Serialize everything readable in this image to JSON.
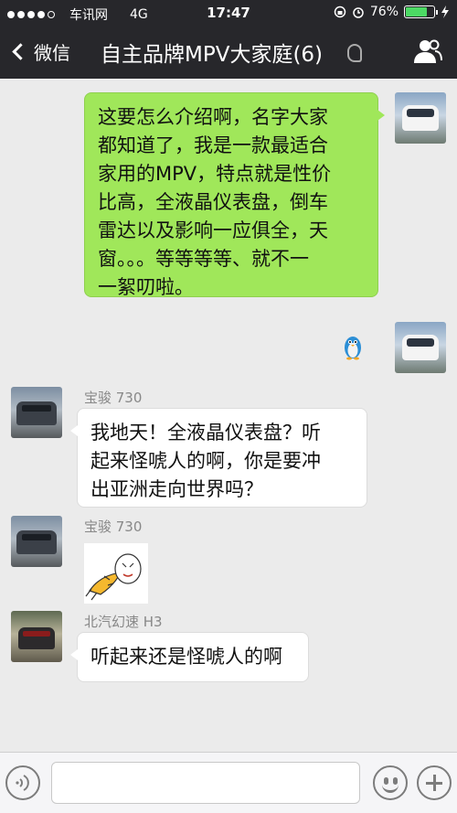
{
  "status_bar": {
    "carrier": "车讯网",
    "network": "4G",
    "time": "17:47",
    "battery": "76%",
    "battery_level": 0.76
  },
  "nav": {
    "back_label": "微信",
    "title": "自主品牌MPV大家庭(6)"
  },
  "messages": [
    {
      "from": "me",
      "type": "text",
      "lines": [
        "这要怎么介绍啊，名字大家",
        "都知道了，我是一款最适合",
        "家用的MPV，特点就是性价",
        "比高，全液晶仪表盘，倒车",
        "雷达以及影响一应俱全，天",
        "窗。。。等等等等、就不一",
        "一絮叨啦。"
      ]
    },
    {
      "from": "me",
      "type": "sticker",
      "sticker": "blue-penguin"
    },
    {
      "from": "them",
      "sender": "宝骏 730",
      "type": "text",
      "lines": [
        "我地天！全液晶仪表盘？听",
        "起来怪唬人的啊，你是要冲",
        "出亚洲走向世界吗？"
      ]
    },
    {
      "from": "them",
      "sender": "宝骏 730",
      "type": "sticker",
      "sticker": "bowing-cartoon"
    },
    {
      "from": "them",
      "sender": "北汽幻速 H3",
      "type": "text",
      "lines": [
        "听起来还是怪唬人的啊"
      ]
    }
  ],
  "input": {
    "placeholder": ""
  }
}
